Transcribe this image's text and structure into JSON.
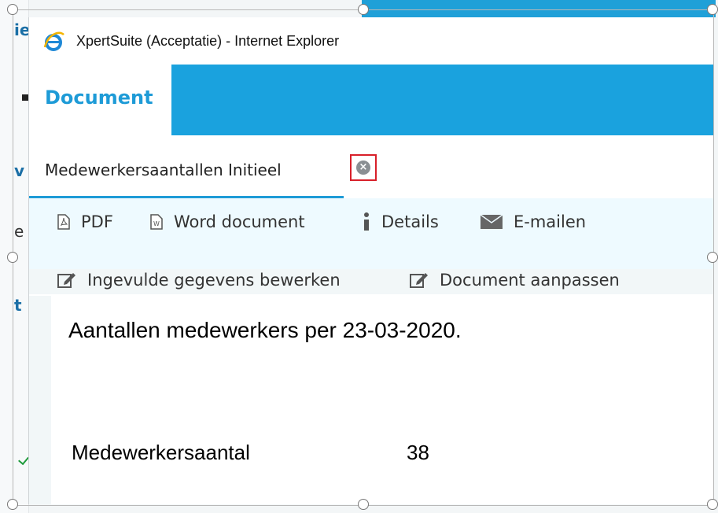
{
  "background_app": {
    "left_letters": [
      "ie",
      "v",
      "e",
      "t"
    ],
    "accent_color": "#1fa0d8"
  },
  "window": {
    "title": "XpertSuite (Acceptatie) - Internet Explorer",
    "icon": "ie-logo-icon"
  },
  "header": {
    "title": "Document",
    "accent_color": "#1aa2de"
  },
  "tab": {
    "label": "Medewerkersaantallen Initieel",
    "close_icon": "close-circle-icon",
    "highlight_color": "#d8202a"
  },
  "toolbar": {
    "row1": [
      {
        "label": "PDF",
        "icon": "pdf-file-icon"
      },
      {
        "label": "Word document",
        "icon": "word-file-icon"
      },
      {
        "label": "Details",
        "icon": "info-icon"
      },
      {
        "label": "E-mailen",
        "icon": "envelope-icon"
      }
    ],
    "row2": [
      {
        "label": "Ingevulde gegevens bewerken",
        "icon": "edit-icon"
      },
      {
        "label": "Document aanpassen",
        "icon": "edit-icon"
      }
    ]
  },
  "document": {
    "heading": "Aantallen medewerkers per 23-03-2020.",
    "row": {
      "label": "Medewerkersaantal",
      "value": "38"
    }
  }
}
